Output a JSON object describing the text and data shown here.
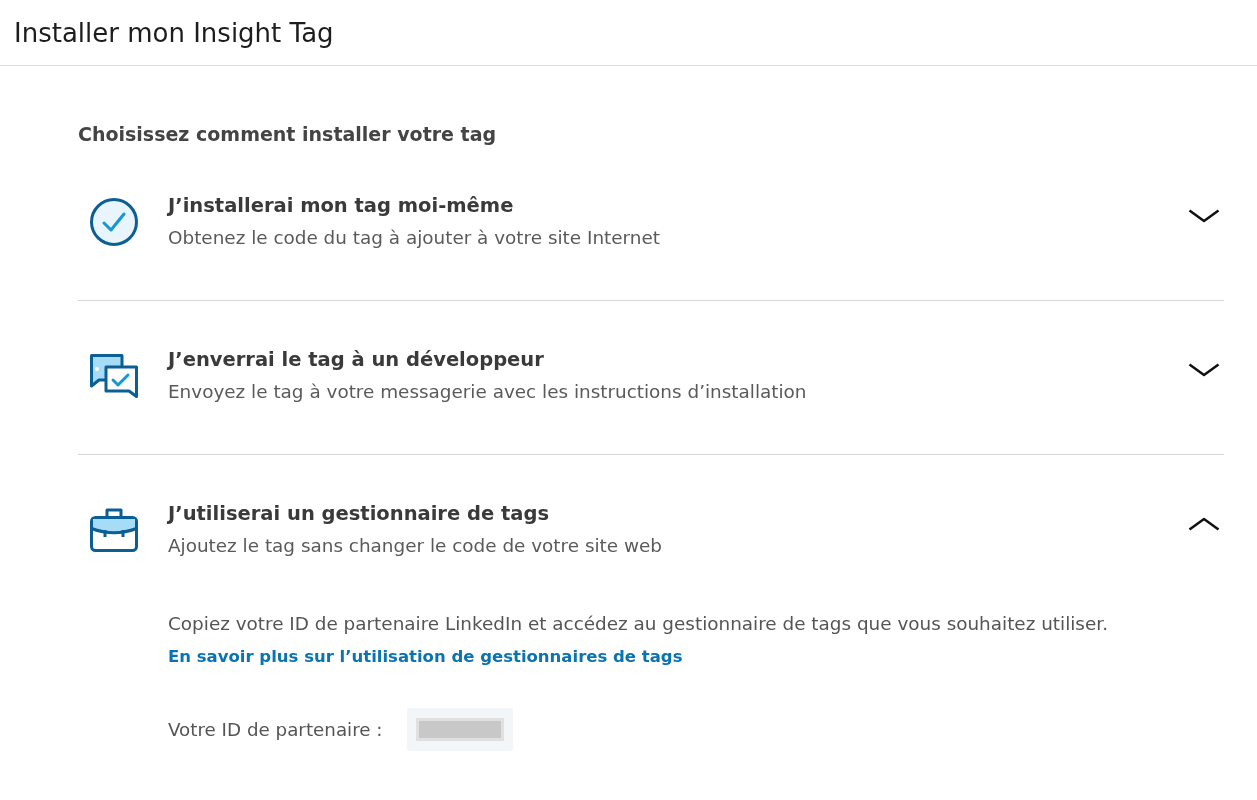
{
  "header": {
    "title": "Installer mon Insight Tag"
  },
  "heading": "Choisissez comment installer votre tag",
  "options": [
    {
      "kind": "self_install",
      "title": "J’installerai mon tag moi-même",
      "description": "Obtenez le code du tag à ajouter à votre site Internet",
      "expanded": false
    },
    {
      "kind": "send_to_developer",
      "title": "J’enverrai le tag à un développeur",
      "description": "Envoyez le tag à votre messagerie avec les instructions d’installation",
      "expanded": false
    },
    {
      "kind": "tag_manager",
      "title": "J’utiliserai un gestionnaire de tags",
      "description": "Ajoutez le tag sans changer le code de votre site web",
      "expanded": true,
      "details": {
        "instructions": "Copiez votre ID de partenaire LinkedIn et accédez au gestionnaire de tags que vous souhaitez utiliser.",
        "link": "En savoir plus sur l’utilisation de gestionnaires de tags",
        "partner_id": {
          "label": "Votre ID de partenaire :",
          "redacted": true
        }
      }
    }
  ]
}
